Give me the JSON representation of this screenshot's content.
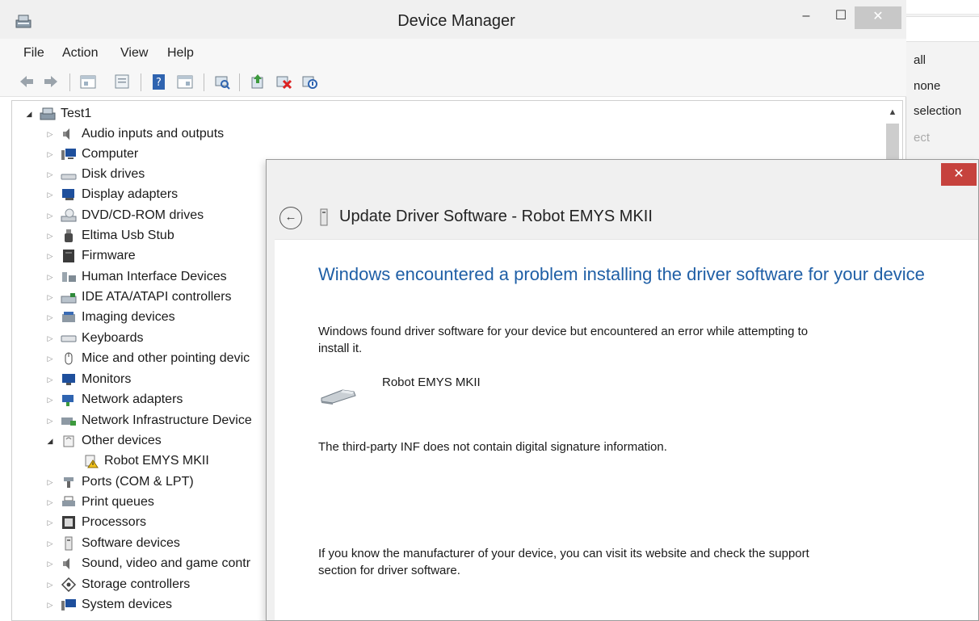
{
  "background_window": {
    "items": [
      "all",
      "none",
      "selection",
      "ect"
    ]
  },
  "device_manager": {
    "title": "Device Manager",
    "window_controls": {
      "minimize": "–",
      "maximize": "☐",
      "close": "✕"
    },
    "menu": [
      "File",
      "Action",
      "View",
      "Help"
    ],
    "toolbar_icons": [
      "back-icon",
      "forward-icon",
      "properties-icon",
      "show-hidden-icon",
      "help-icon",
      "console-tree-icon",
      "scan-hardware-icon",
      "update-driver-icon",
      "uninstall-icon",
      "disable-icon"
    ],
    "tree": {
      "root": "Test1",
      "items": [
        {
          "label": "Audio inputs and outputs",
          "icon": "speaker-icon",
          "expanded": false
        },
        {
          "label": "Computer",
          "icon": "computer-icon",
          "expanded": false
        },
        {
          "label": "Disk drives",
          "icon": "disk-drive-icon",
          "expanded": false
        },
        {
          "label": "Display adapters",
          "icon": "display-adapter-icon",
          "expanded": false
        },
        {
          "label": "DVD/CD-ROM drives",
          "icon": "dvd-drive-icon",
          "expanded": false
        },
        {
          "label": "Eltima Usb Stub",
          "icon": "usb-icon",
          "expanded": false
        },
        {
          "label": "Firmware",
          "icon": "firmware-icon",
          "expanded": false
        },
        {
          "label": "Human Interface Devices",
          "icon": "hid-icon",
          "expanded": false
        },
        {
          "label": "IDE ATA/ATAPI controllers",
          "icon": "ide-controller-icon",
          "expanded": false
        },
        {
          "label": "Imaging devices",
          "icon": "imaging-device-icon",
          "expanded": false
        },
        {
          "label": "Keyboards",
          "icon": "keyboard-icon",
          "expanded": false
        },
        {
          "label": "Mice and other pointing devic",
          "icon": "mouse-icon",
          "expanded": false
        },
        {
          "label": "Monitors",
          "icon": "monitor-icon",
          "expanded": false
        },
        {
          "label": "Network adapters",
          "icon": "network-adapter-icon",
          "expanded": false
        },
        {
          "label": "Network Infrastructure Device",
          "icon": "network-infrastructure-icon",
          "expanded": false
        },
        {
          "label": "Other devices",
          "icon": "other-devices-icon",
          "expanded": true
        },
        {
          "label": "Robot EMYS MKII",
          "icon": "warning-device-icon",
          "child": true
        },
        {
          "label": "Ports (COM & LPT)",
          "icon": "port-icon",
          "expanded": false
        },
        {
          "label": "Print queues",
          "icon": "printer-icon",
          "expanded": false
        },
        {
          "label": "Processors",
          "icon": "processor-icon",
          "expanded": false
        },
        {
          "label": "Software devices",
          "icon": "software-device-icon",
          "expanded": false
        },
        {
          "label": "Sound, video and game contr",
          "icon": "sound-icon",
          "expanded": false
        },
        {
          "label": "Storage controllers",
          "icon": "storage-controller-icon",
          "expanded": false
        },
        {
          "label": "System devices",
          "icon": "system-device-icon",
          "expanded": false
        }
      ]
    }
  },
  "dialog": {
    "title": "Update Driver Software - Robot EMYS MKII",
    "close": "✕",
    "back": "←",
    "heading": "Windows encountered a problem installing the driver software for your device",
    "message_line1": "Windows found driver software for your device but encountered an error while attempting to",
    "message_line2": "install it.",
    "device_name": "Robot EMYS MKII",
    "error_detail": "The third-party INF does not contain digital signature information.",
    "footer_line1": "If you know the manufacturer of your device, you can visit its website and check the support",
    "footer_line2": "section for driver software."
  },
  "colors": {
    "heading_blue": "#1f5fa6",
    "dialog_close_red": "#c6423d",
    "window_bg": "#f0f0f0"
  }
}
